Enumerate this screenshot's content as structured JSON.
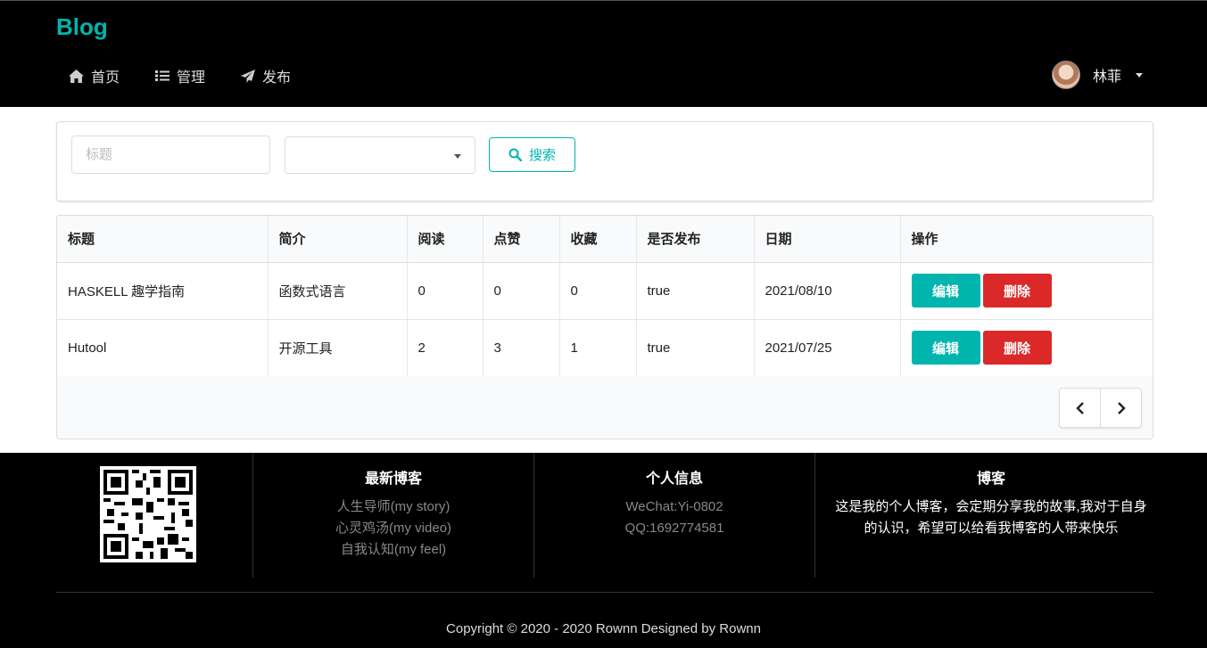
{
  "header": {
    "brand": "Blog",
    "nav": [
      {
        "label": "首页",
        "icon": "home-icon"
      },
      {
        "label": "管理",
        "icon": "list-icon"
      },
      {
        "label": "发布",
        "icon": "paper-plane-icon"
      }
    ],
    "user_name": "林菲"
  },
  "search": {
    "title_placeholder": "标题",
    "type_value": "",
    "button_label": "搜索"
  },
  "table": {
    "columns": [
      "标题",
      "简介",
      "阅读",
      "点赞",
      "收藏",
      "是否发布",
      "日期",
      "操作"
    ],
    "rows": [
      {
        "title": "HASKELL 趣学指南",
        "intro": "函数式语言",
        "reads": "0",
        "likes": "0",
        "favorites": "0",
        "published": "true",
        "date": "2021/08/10"
      },
      {
        "title": "Hutool",
        "intro": "开源工具",
        "reads": "2",
        "likes": "3",
        "favorites": "1",
        "published": "true",
        "date": "2021/07/25"
      }
    ],
    "edit_label": "编辑",
    "delete_label": "删除"
  },
  "footer": {
    "latest_title": "最新博客",
    "latest_links": [
      "人生导师(my story)",
      "心灵鸡汤(my video)",
      "自我认知(my feel)"
    ],
    "info_title": "个人信息",
    "info_lines": [
      "WeChat:Yi-0802",
      "QQ:1692774581"
    ],
    "blog_title": "博客",
    "blog_text": "这是我的个人博客，会定期分享我的故事,我对于自身的认识，希望可以给看我博客的人带来快乐",
    "copyright": "Copyright © 2020 - 2020 Rownn Designed by Rownn"
  },
  "colors": {
    "accent": "#00b5ad",
    "danger": "#db2828",
    "header_bg": "#000000"
  }
}
